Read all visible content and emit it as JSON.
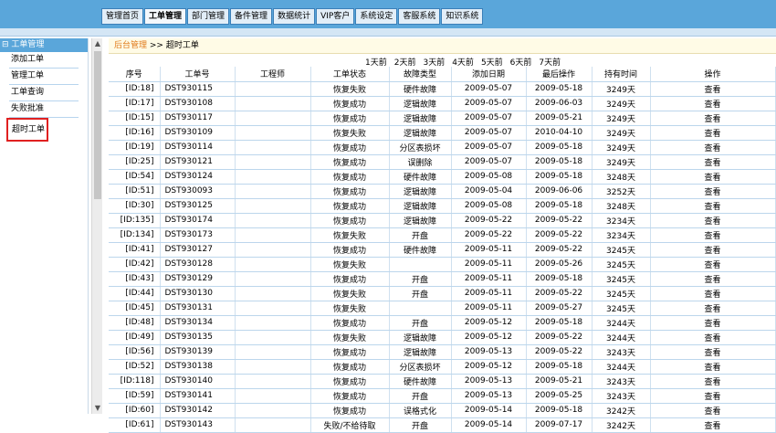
{
  "tabs": [
    {
      "label": "管理首页",
      "active": false
    },
    {
      "label": "工单管理",
      "active": true
    },
    {
      "label": "部门管理",
      "active": false
    },
    {
      "label": "备件管理",
      "active": false
    },
    {
      "label": "数据统计",
      "active": false
    },
    {
      "label": "VIP客户",
      "active": false
    },
    {
      "label": "系统设定",
      "active": false
    },
    {
      "label": "客服系统",
      "active": false
    },
    {
      "label": "知识系统",
      "active": false
    }
  ],
  "sidebar": {
    "title": "⊟ 工单管理",
    "items": [
      {
        "label": "添加工单",
        "selected": false
      },
      {
        "label": "管理工单",
        "selected": false
      },
      {
        "label": "工单查询",
        "selected": false
      },
      {
        "label": "失败批准",
        "selected": false
      },
      {
        "label": "超时工单",
        "selected": true
      }
    ]
  },
  "breadcrumb": {
    "home": "后台管理",
    "current": ">> 超时工单"
  },
  "day_filters": [
    "1天前",
    "2天前",
    "3天前",
    "4天前",
    "5天前",
    "6天前",
    "7天前"
  ],
  "table": {
    "headers": [
      "序号",
      "工单号",
      "工程师",
      "工单状态",
      "故障类型",
      "添加日期",
      "最后操作",
      "持有时间",
      "操作"
    ],
    "rows": [
      [
        "[ID:18]",
        "DST930115",
        "",
        "恢复失败",
        "硬件故障",
        "2009-05-07",
        "2009-05-18",
        "3249天",
        "查看"
      ],
      [
        "[ID:17]",
        "DST930108",
        "",
        "恢复成功",
        "逻辑故障",
        "2009-05-07",
        "2009-06-03",
        "3249天",
        "查看"
      ],
      [
        "[ID:15]",
        "DST930117",
        "",
        "恢复成功",
        "逻辑故障",
        "2009-05-07",
        "2009-05-21",
        "3249天",
        "查看"
      ],
      [
        "[ID:16]",
        "DST930109",
        "",
        "恢复失败",
        "逻辑故障",
        "2009-05-07",
        "2010-04-10",
        "3249天",
        "查看"
      ],
      [
        "[ID:19]",
        "DST930114",
        "",
        "恢复成功",
        "分区表损坏",
        "2009-05-07",
        "2009-05-18",
        "3249天",
        "查看"
      ],
      [
        "[ID:25]",
        "DST930121",
        "",
        "恢复成功",
        "误删除",
        "2009-05-07",
        "2009-05-18",
        "3249天",
        "查看"
      ],
      [
        "[ID:54]",
        "DST930124",
        "",
        "恢复成功",
        "硬件故障",
        "2009-05-08",
        "2009-05-18",
        "3248天",
        "查看"
      ],
      [
        "[ID:51]",
        "DST930093",
        "",
        "恢复成功",
        "逻辑故障",
        "2009-05-04",
        "2009-06-06",
        "3252天",
        "查看"
      ],
      [
        "[ID:30]",
        "DST930125",
        "",
        "恢复成功",
        "逻辑故障",
        "2009-05-08",
        "2009-05-18",
        "3248天",
        "查看"
      ],
      [
        "[ID:135]",
        "DST930174",
        "",
        "恢复成功",
        "逻辑故障",
        "2009-05-22",
        "2009-05-22",
        "3234天",
        "查看"
      ],
      [
        "[ID:134]",
        "DST930173",
        "",
        "恢复失败",
        "开盘",
        "2009-05-22",
        "2009-05-22",
        "3234天",
        "查看"
      ],
      [
        "[ID:41]",
        "DST930127",
        "",
        "恢复成功",
        "硬件故障",
        "2009-05-11",
        "2009-05-22",
        "3245天",
        "查看"
      ],
      [
        "[ID:42]",
        "DST930128",
        "",
        "恢复失败",
        "",
        "2009-05-11",
        "2009-05-26",
        "3245天",
        "查看"
      ],
      [
        "[ID:43]",
        "DST930129",
        "",
        "恢复成功",
        "开盘",
        "2009-05-11",
        "2009-05-18",
        "3245天",
        "查看"
      ],
      [
        "[ID:44]",
        "DST930130",
        "",
        "恢复失败",
        "开盘",
        "2009-05-11",
        "2009-05-22",
        "3245天",
        "查看"
      ],
      [
        "[ID:45]",
        "DST930131",
        "",
        "恢复失败",
        "",
        "2009-05-11",
        "2009-05-27",
        "3245天",
        "查看"
      ],
      [
        "[ID:48]",
        "DST930134",
        "",
        "恢复成功",
        "开盘",
        "2009-05-12",
        "2009-05-18",
        "3244天",
        "查看"
      ],
      [
        "[ID:49]",
        "DST930135",
        "",
        "恢复失败",
        "逻辑故障",
        "2009-05-12",
        "2009-05-22",
        "3244天",
        "查看"
      ],
      [
        "[ID:56]",
        "DST930139",
        "",
        "恢复成功",
        "逻辑故障",
        "2009-05-13",
        "2009-05-22",
        "3243天",
        "查看"
      ],
      [
        "[ID:52]",
        "DST930138",
        "",
        "恢复成功",
        "分区表损坏",
        "2009-05-12",
        "2009-05-18",
        "3244天",
        "查看"
      ],
      [
        "[ID:118]",
        "DST930140",
        "",
        "恢复成功",
        "硬件故障",
        "2009-05-13",
        "2009-05-21",
        "3243天",
        "查看"
      ],
      [
        "[ID:59]",
        "DST930141",
        "",
        "恢复成功",
        "开盘",
        "2009-05-13",
        "2009-05-25",
        "3243天",
        "查看"
      ],
      [
        "[ID:60]",
        "DST930142",
        "",
        "恢复成功",
        "误格式化",
        "2009-05-14",
        "2009-05-18",
        "3242天",
        "查看"
      ],
      [
        "[ID:61]",
        "DST930143",
        "",
        "失败/不给待取",
        "开盘",
        "2009-05-14",
        "2009-07-17",
        "3242天",
        "查看"
      ]
    ]
  }
}
